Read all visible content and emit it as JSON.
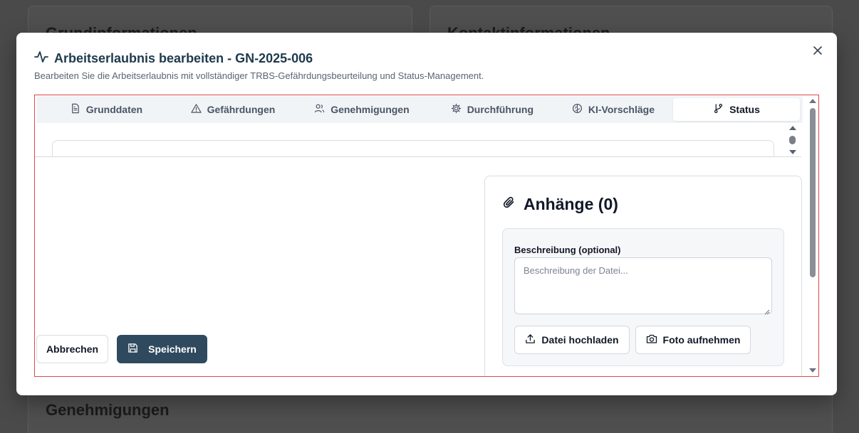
{
  "background": {
    "left_card_title": "Grundinformationen",
    "right_card_title": "Kontaktinformationen",
    "bottom_card_title": "Genehmigungen"
  },
  "modal": {
    "title": "Arbeitserlaubnis bearbeiten - GN-2025-006",
    "description": "Bearbeiten Sie die Arbeitserlaubnis mit vollständiger TRBS-Gefährdungsbeurteilung und Status-Management.",
    "close_icon": "close-icon",
    "title_icon": "activity-icon"
  },
  "tabs": [
    {
      "label": "Grunddaten",
      "icon": "file-text-icon"
    },
    {
      "label": "Gefährdungen",
      "icon": "alert-triangle-icon"
    },
    {
      "label": "Genehmigungen",
      "icon": "users-icon"
    },
    {
      "label": "Durchführung",
      "icon": "gear-icon"
    },
    {
      "label": "KI-Vorschläge",
      "icon": "brain-icon"
    },
    {
      "label": "Status",
      "icon": "git-branch-icon",
      "active": true
    }
  ],
  "actions": {
    "cancel_label": "Abbrechen",
    "save_label": "Speichern"
  },
  "attachments": {
    "title": "Anhänge (0)",
    "description_label": "Beschreibung (optional)",
    "description_placeholder": "Beschreibung der Datei...",
    "upload_label": "Datei hochladen",
    "photo_label": "Foto aufnehmen"
  },
  "colors": {
    "primary": "#2f4a5e",
    "frame_outline": "#e0474c",
    "title": "#1e3a4c"
  }
}
